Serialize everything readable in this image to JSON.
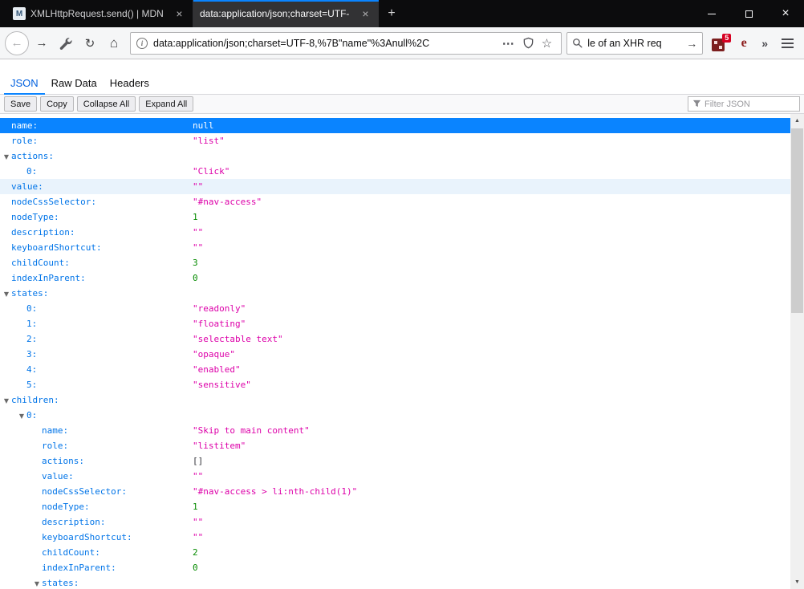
{
  "colors": {
    "accent": "#0a84ff",
    "selection_bg": "#0a84ff",
    "key_color": "#0074e8",
    "string_color": "#dd00a9",
    "number_color": "#058b00",
    "badge_color": "#d70022",
    "titlebar_bg": "#0c0c0d"
  },
  "titlebar": {
    "tabs": [
      {
        "title": "XMLHttpRequest.send() | MDN"
      },
      {
        "title": "data:application/json;charset=UTF-"
      }
    ],
    "favicon_letter": "M",
    "tab_close": "×",
    "new_tab": "+",
    "close": "×"
  },
  "navbar": {
    "back": "←",
    "forward": "→",
    "reload": "↻",
    "home": "⌂",
    "info": "i",
    "url": "data:application/json;charset=UTF-8,%7B\"name\"%3Anull%2C",
    "page_actions": "⋯",
    "star": "☆",
    "search_text": "le of an XHR req",
    "search_go": "→",
    "extension_badge": "5",
    "extension2_glyph": "e",
    "overflow": "»"
  },
  "viewer": {
    "tabs": [
      {
        "label": "JSON"
      },
      {
        "label": "Raw Data"
      },
      {
        "label": "Headers"
      }
    ],
    "buttons": [
      "Save",
      "Copy",
      "Collapse All",
      "Expand All"
    ],
    "filter_placeholder": "Filter JSON"
  },
  "tree": {
    "twisty": "▼",
    "scroll_up": "▲",
    "scroll_down": "▼",
    "rows": [
      {
        "indent": 0,
        "twisty": false,
        "key": "name:",
        "value": "null",
        "type": "null",
        "state": "selected"
      },
      {
        "indent": 0,
        "twisty": false,
        "key": "role:",
        "value": "\"list\"",
        "type": "string",
        "state": ""
      },
      {
        "indent": 0,
        "twisty": true,
        "key": "actions:",
        "value": "",
        "type": "none",
        "state": ""
      },
      {
        "indent": 1,
        "twisty": false,
        "key": "0:",
        "value": "\"Click\"",
        "type": "string",
        "state": ""
      },
      {
        "indent": 0,
        "twisty": false,
        "key": "value:",
        "value": "\"\"",
        "type": "string",
        "state": "hover"
      },
      {
        "indent": 0,
        "twisty": false,
        "key": "nodeCssSelector:",
        "value": "\"#nav-access\"",
        "type": "string",
        "state": ""
      },
      {
        "indent": 0,
        "twisty": false,
        "key": "nodeType:",
        "value": "1",
        "type": "number",
        "state": ""
      },
      {
        "indent": 0,
        "twisty": false,
        "key": "description:",
        "value": "\"\"",
        "type": "string",
        "state": ""
      },
      {
        "indent": 0,
        "twisty": false,
        "key": "keyboardShortcut:",
        "value": "\"\"",
        "type": "string",
        "state": ""
      },
      {
        "indent": 0,
        "twisty": false,
        "key": "childCount:",
        "value": "3",
        "type": "number",
        "state": ""
      },
      {
        "indent": 0,
        "twisty": false,
        "key": "indexInParent:",
        "value": "0",
        "type": "number",
        "state": ""
      },
      {
        "indent": 0,
        "twisty": true,
        "key": "states:",
        "value": "",
        "type": "none",
        "state": ""
      },
      {
        "indent": 1,
        "twisty": false,
        "key": "0:",
        "value": "\"readonly\"",
        "type": "string",
        "state": ""
      },
      {
        "indent": 1,
        "twisty": false,
        "key": "1:",
        "value": "\"floating\"",
        "type": "string",
        "state": ""
      },
      {
        "indent": 1,
        "twisty": false,
        "key": "2:",
        "value": "\"selectable text\"",
        "type": "string",
        "state": ""
      },
      {
        "indent": 1,
        "twisty": false,
        "key": "3:",
        "value": "\"opaque\"",
        "type": "string",
        "state": ""
      },
      {
        "indent": 1,
        "twisty": false,
        "key": "4:",
        "value": "\"enabled\"",
        "type": "string",
        "state": ""
      },
      {
        "indent": 1,
        "twisty": false,
        "key": "5:",
        "value": "\"sensitive\"",
        "type": "string",
        "state": ""
      },
      {
        "indent": 0,
        "twisty": true,
        "key": "children:",
        "value": "",
        "type": "none",
        "state": ""
      },
      {
        "indent": 1,
        "twisty": true,
        "key": "0:",
        "value": "",
        "type": "none",
        "state": ""
      },
      {
        "indent": 2,
        "twisty": false,
        "key": "name:",
        "value": "\"Skip to main content\"",
        "type": "string",
        "state": ""
      },
      {
        "indent": 2,
        "twisty": false,
        "key": "role:",
        "value": "\"listitem\"",
        "type": "string",
        "state": ""
      },
      {
        "indent": 2,
        "twisty": false,
        "key": "actions:",
        "value": "[]",
        "type": "array",
        "state": ""
      },
      {
        "indent": 2,
        "twisty": false,
        "key": "value:",
        "value": "\"\"",
        "type": "string",
        "state": ""
      },
      {
        "indent": 2,
        "twisty": false,
        "key": "nodeCssSelector:",
        "value": "\"#nav-access > li:nth-child(1)\"",
        "type": "string",
        "state": ""
      },
      {
        "indent": 2,
        "twisty": false,
        "key": "nodeType:",
        "value": "1",
        "type": "number",
        "state": ""
      },
      {
        "indent": 2,
        "twisty": false,
        "key": "description:",
        "value": "\"\"",
        "type": "string",
        "state": ""
      },
      {
        "indent": 2,
        "twisty": false,
        "key": "keyboardShortcut:",
        "value": "\"\"",
        "type": "string",
        "state": ""
      },
      {
        "indent": 2,
        "twisty": false,
        "key": "childCount:",
        "value": "2",
        "type": "number",
        "state": ""
      },
      {
        "indent": 2,
        "twisty": false,
        "key": "indexInParent:",
        "value": "0",
        "type": "number",
        "state": ""
      },
      {
        "indent": 2,
        "twisty": true,
        "key": "states:",
        "value": "",
        "type": "none",
        "state": ""
      }
    ]
  }
}
